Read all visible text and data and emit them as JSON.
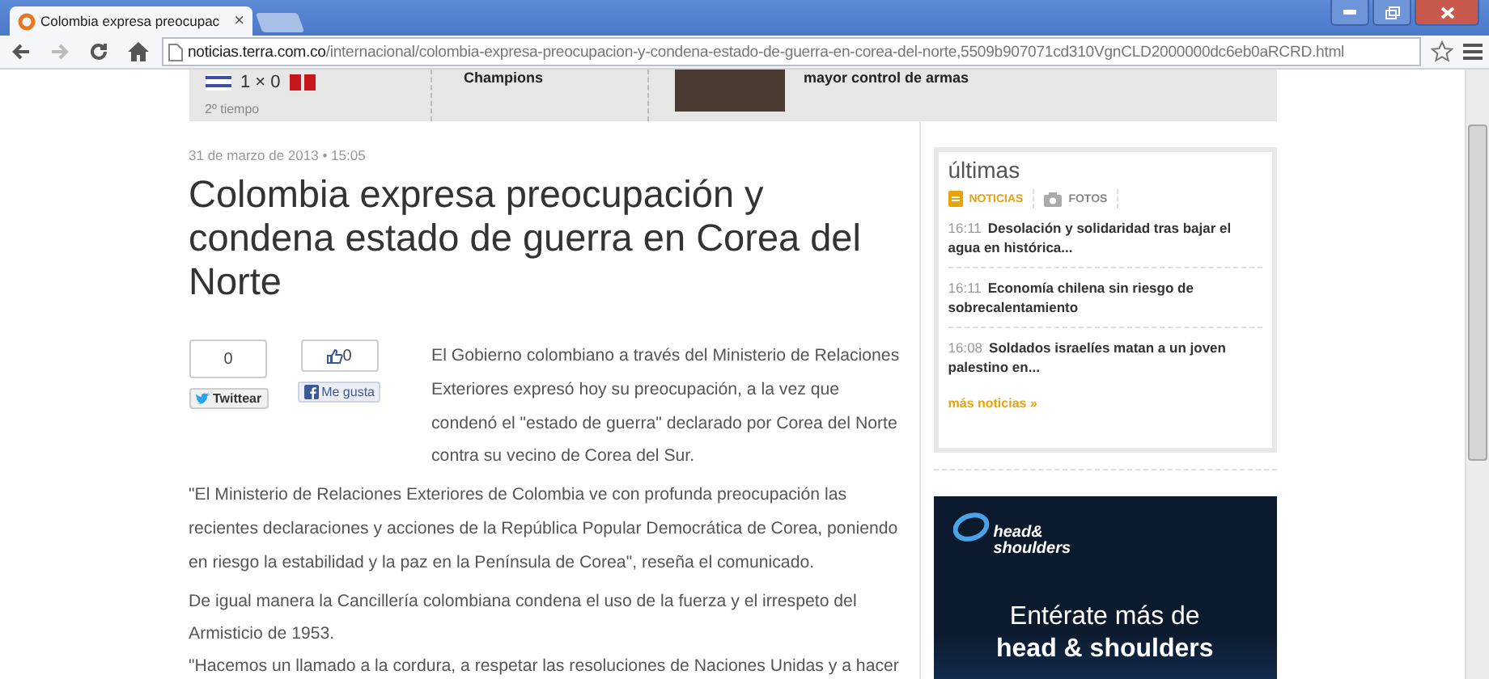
{
  "window": {
    "tab_title": "Colombia expresa preocupac",
    "tab_close": "×",
    "url_host": "noticias.terra.com.co",
    "url_path": "/internacional/colombia-expresa-preocupacion-y-condena-estado-de-guerra-en-corea-del-norte,5509b907071cd310VgnCLD2000000dc6eb0aRCRD.html"
  },
  "top_strip": {
    "score": "1 × 0",
    "period": "2º tiempo",
    "headline_1": "Champions",
    "headline_2": "mayor control de armas"
  },
  "article": {
    "date": "31 de marzo de 2013 • 15:05",
    "title": "Colombia expresa preocupación y condena estado de guerra en Corea del Norte",
    "share": [
      {
        "kind": "twitter",
        "count": "0",
        "label": "Twittear"
      },
      {
        "kind": "facebook",
        "count": "0",
        "label": "Me gusta"
      }
    ],
    "lead": "El Gobierno colombiano a través del Ministerio de Relaciones Exteriores expresó hoy su preocupación, a la vez que condenó el \"estado de guerra\" declarado por Corea del Norte contra su vecino de Corea del Sur.",
    "paragraphs": [
      "\"El Ministerio de Relaciones Exteriores de Colombia ve con profunda preocupación las recientes declaraciones y acciones de la República Popular Democrática de Corea, poniendo en riesgo la estabilidad y la paz en la Península de Corea\", reseña el comunicado.",
      "De igual manera la Cancillería colombiana condena el uso de la fuerza y el irrespeto del Armisticio de 1953.",
      "\"Hacemos un llamado a la cordura, a respetar las resoluciones de Naciones Unidas y a hacer"
    ]
  },
  "sidebar": {
    "title": "últimas",
    "tabs": [
      {
        "kind": "news",
        "label": "NOTICIAS",
        "selected": true
      },
      {
        "kind": "photos",
        "label": "FOTOS",
        "selected": false
      }
    ],
    "news": [
      {
        "time": "16:11",
        "headline": "Desolación y solidaridad tras bajar el agua en histórica..."
      },
      {
        "time": "16:11",
        "headline": "Economía chilena sin riesgo de sobrecalentamiento"
      },
      {
        "time": "16:08",
        "headline": "Soldados israelíes matan a un joven palestino en..."
      }
    ],
    "more": "más noticias »"
  },
  "ad": {
    "logo_lines": [
      "head&",
      "shoulders"
    ],
    "line_1": "Entérate más de",
    "line_2": "head & shoulders"
  }
}
